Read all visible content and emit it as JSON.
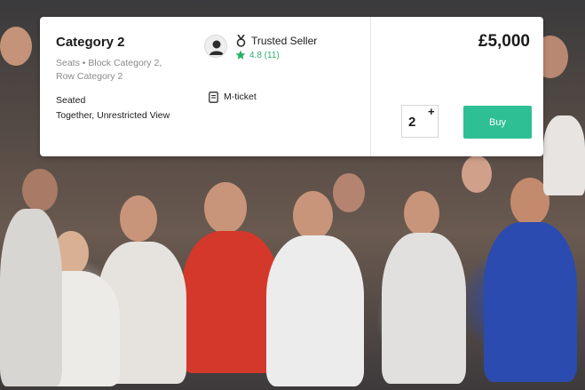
{
  "listing": {
    "category_title": "Category 2",
    "seats_description": "Seats • Block Category 2, Row Category 2",
    "seating_note": "Seated",
    "view_note": "Together, Unrestricted View",
    "seller_badge": "Trusted Seller",
    "seller_rating": "4.8 (11)",
    "ticket_type": "M-ticket",
    "price": "£5,000",
    "quantity": "2",
    "quantity_increment": "+",
    "buy_label": "Buy"
  },
  "icons": {
    "seller_avatar": "person-avatar-icon",
    "badge": "medal-icon",
    "rating": "star-icon",
    "ticket": "mobile-ticket-icon"
  },
  "colors": {
    "accent": "#2ebf94",
    "rating": "#2bb06b"
  }
}
